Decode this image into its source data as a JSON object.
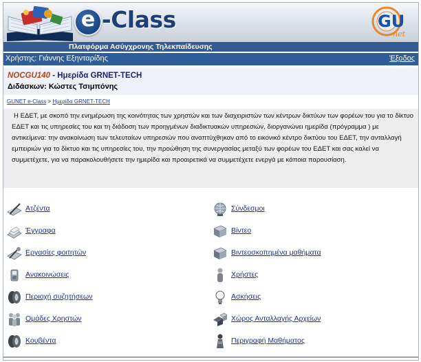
{
  "header": {
    "brand": "e-Class",
    "brand_letter": "e",
    "subtitle": "Πλατφόρμα Ασύγχρονης Τηλεκπαίδευσης",
    "partner_logo_text": "GU",
    "partner_logo_sub": "net"
  },
  "userbar": {
    "user_label": "Χρήστης: Γιάννης Εξηνταρίδης",
    "logout_label": "Έξοδος"
  },
  "course": {
    "code": "NOCGU140",
    "separator": " - ",
    "title": "Ημερίδα GRNET-TECH",
    "instructor": "Διδάσκων: Κώστες Τσιμπόνης"
  },
  "breadcrumb": {
    "home": "GUNET e-Class",
    "separator": " > ",
    "current": "Ημερίδα GRNET-TECH"
  },
  "description": "Η ΕΔΕΤ, με σκοπό την ενημέρωση της κοινότητας των χρηστών και των διαχειριστών των κέντρων δικτύων των φορέων του για το δίκτυο ΕΔΕΤ και τις υπηρεσίες του και τη διάδοση των προηγμένων διαδικτυακών υπηρεσιών, διοργανώνει ημερίδα (πρόγραμμα ) με αντικείμενα: την ανακοίνωση των τελευταίων υπηρεσιών που αναπτύχθηκαν από το εικονικό κέντρο δικτύου του ΕΔΕΤ, την ανταλλαγή εμπειριών για το δίκτυο και τις υπηρεσίες του, την προώθηση της συνεργασίας μεταξύ των φορέων του ΕΔΕΤ και σας καλεί να συμμετέχετε, για να παρακολουθήσετε την ημερίδα και προαιρετικά να συμμετέχετε ενεργά με κάποια παρουσίαση.",
  "tools_left": [
    {
      "label": "Ατζέντα",
      "icon": "agenda-icon"
    },
    {
      "label": "Έγγραφα",
      "icon": "documents-icon"
    },
    {
      "label": "Εργασίες φοιτητών",
      "icon": "assignments-icon"
    },
    {
      "label": "Ανακοινώσεις",
      "icon": "announcements-icon"
    },
    {
      "label": "Περιοχή συζητήσεων",
      "icon": "forum-icon"
    },
    {
      "label": "Ομάδες Χρηστών",
      "icon": "user-groups-icon"
    },
    {
      "label": "Κουβέντα",
      "icon": "chat-icon"
    }
  ],
  "tools_right": [
    {
      "label": "Σύνδεσμοι",
      "icon": "links-globe-icon"
    },
    {
      "label": "Βίντεο",
      "icon": "video-icon"
    },
    {
      "label": "Βιντεοσκοπημένα μαθήματα",
      "icon": "recorded-lessons-icon"
    },
    {
      "label": "Χρήστες",
      "icon": "users-icon"
    },
    {
      "label": "Ασκήσεις",
      "icon": "exercises-lightbulb-icon"
    },
    {
      "label": "Χώρος Ανταλλαγής Αρχείων",
      "icon": "file-exchange-icon"
    },
    {
      "label": "Περιγραφή Μαθήματος",
      "icon": "course-description-icon"
    }
  ],
  "colors": {
    "banner_bar": "#345c93",
    "userbar": "#2f5d97",
    "link": "#1d2f8a",
    "course_code": "#b5461b"
  }
}
